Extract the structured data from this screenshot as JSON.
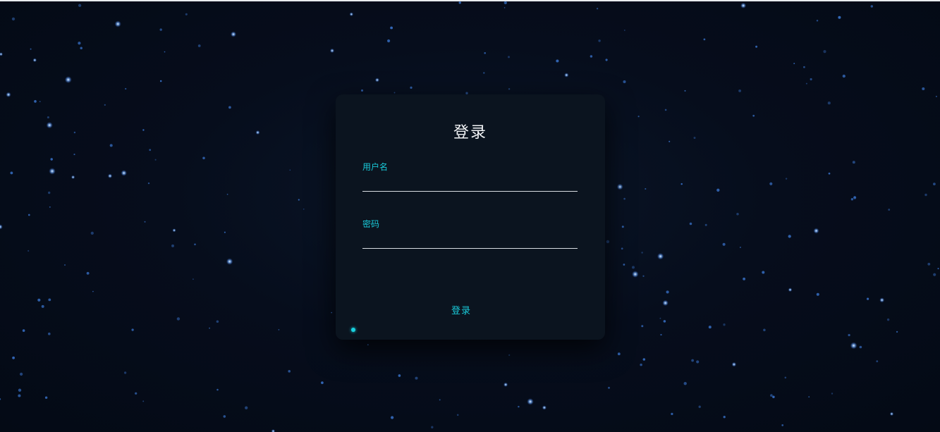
{
  "login": {
    "title": "登录",
    "username_label": "用户名",
    "username_value": "",
    "password_label": "密码",
    "password_value": "",
    "submit_label": "登录"
  },
  "colors": {
    "background": "#050b17",
    "card": "#0b141f",
    "accent": "#19c9d8",
    "title_text": "#f2f4f6",
    "star": "#5aa0ff"
  }
}
